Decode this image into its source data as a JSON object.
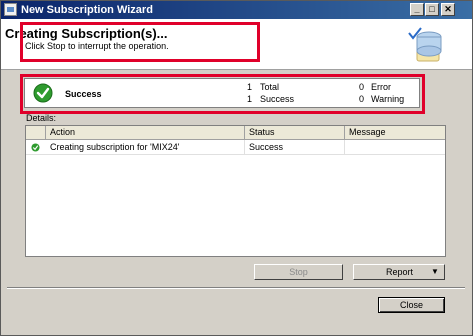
{
  "window": {
    "title": "New Subscription Wizard"
  },
  "header": {
    "heading": "Creating Subscription(s)...",
    "subheading": "Click Stop to interrupt the operation."
  },
  "summary": {
    "status": "Success",
    "total_count": "1",
    "total_label": "Total",
    "success_count": "1",
    "success_label": "Success",
    "error_count": "0",
    "error_label": "Error",
    "warning_count": "0",
    "warning_label": "Warning"
  },
  "details": {
    "label": "Details:",
    "columns": [
      "Action",
      "Status",
      "Message"
    ],
    "rows": [
      {
        "action": "Creating subscription for 'MIX24'",
        "status": "Success",
        "message": ""
      }
    ]
  },
  "buttons": {
    "stop": "Stop",
    "report": "Report",
    "close": "Close"
  },
  "colors": {
    "highlight_box": "#e0002a",
    "success": "#2e9b2e",
    "title_bar": "#0a246a"
  }
}
